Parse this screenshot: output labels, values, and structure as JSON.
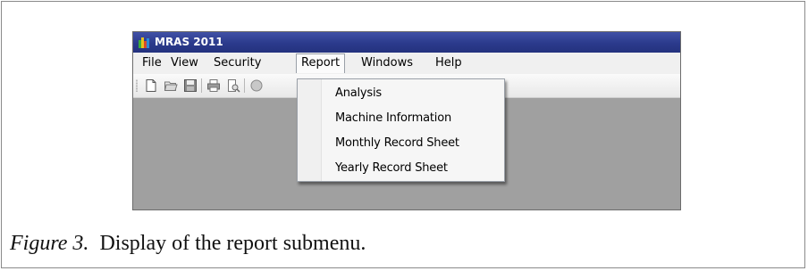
{
  "window": {
    "title": "MRAS 2011"
  },
  "menubar": {
    "items": [
      {
        "label": "File"
      },
      {
        "label": "View"
      },
      {
        "label": "Security"
      },
      {
        "label": "Report"
      },
      {
        "label": "Windows"
      },
      {
        "label": "Help"
      }
    ],
    "active": "Report"
  },
  "toolbar": {
    "icons": [
      "new-document-icon",
      "open-folder-icon",
      "save-icon",
      "print-icon",
      "print-preview-icon",
      "extra-icon"
    ]
  },
  "report_menu": {
    "items": [
      {
        "label": "Analysis"
      },
      {
        "label": "Machine Information"
      },
      {
        "label": "Monthly Record Sheet"
      },
      {
        "label": "Yearly Record Sheet"
      }
    ]
  },
  "caption": {
    "figure_label": "Figure 3.",
    "text": "Display of the report submenu."
  },
  "colors": {
    "titlebar": "#2b3a8c",
    "client_area": "#a0a0a0",
    "menubar": "#f0f0f0"
  }
}
